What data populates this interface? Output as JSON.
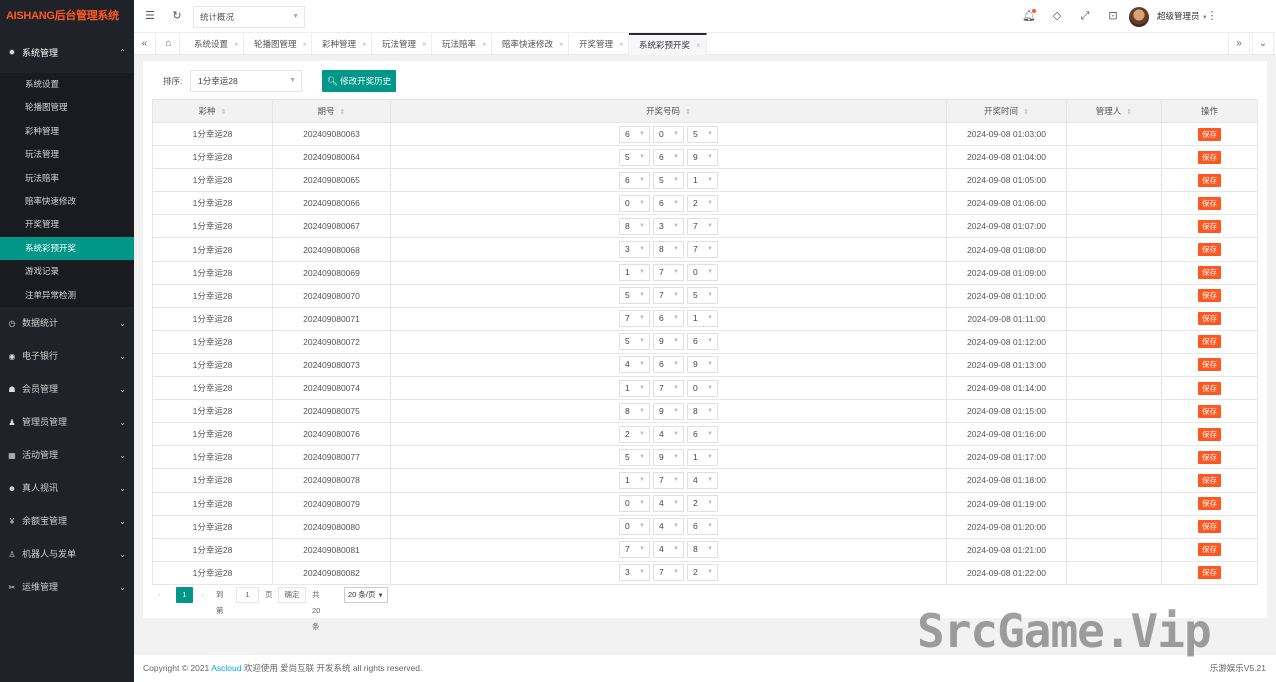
{
  "brand": {
    "logo_text": "AISHANG后台管理系统",
    "accent": "#009688",
    "danger": "#ff5722"
  },
  "sidebar": {
    "groups": [
      {
        "label": "系统管理",
        "icon": "gear-icon",
        "expanded": true,
        "items": [
          "系统设置",
          "轮播图管理",
          "彩种管理",
          "玩法管理",
          "玩法赔率",
          "赔率快速修改",
          "开奖管理",
          "系统彩预开奖",
          "游戏记录",
          "注单异常检测"
        ],
        "active_index": 7
      },
      {
        "label": "数据统计",
        "icon": "clock-icon"
      },
      {
        "label": "电子银行",
        "icon": "coin-icon"
      },
      {
        "label": "会员管理",
        "icon": "user-group-icon"
      },
      {
        "label": "管理员管理",
        "icon": "admin-icon"
      },
      {
        "label": "活动管理",
        "icon": "calendar-icon"
      },
      {
        "label": "真人视讯",
        "icon": "users-icon"
      },
      {
        "label": "余额宝管理",
        "icon": "yen-icon"
      },
      {
        "label": "机器人与发单",
        "icon": "robot-icon"
      },
      {
        "label": "运维管理",
        "icon": "tools-icon"
      }
    ]
  },
  "topbar": {
    "dropdown_value": "统计概况",
    "username": "超级管理员"
  },
  "tabs": {
    "items": [
      "系统设置",
      "轮播图管理",
      "彩种管理",
      "玩法管理",
      "玩法赔率",
      "赔率快速修改",
      "开奖管理",
      "系统彩预开奖"
    ],
    "active_index": 7
  },
  "toolbar": {
    "sort_label": "排序:",
    "sort_value": "1分幸运28",
    "history_button": "修改开奖历史"
  },
  "table": {
    "columns": [
      "彩种",
      "期号",
      "开奖号码",
      "开奖时间",
      "管理人",
      "操作"
    ],
    "action_label": "保存",
    "rows": [
      {
        "lottery": "1分幸运28",
        "issue": "202409080063",
        "digits": [
          "6",
          "0",
          "5"
        ],
        "time": "2024-09-08 01:03:00",
        "manager": ""
      },
      {
        "lottery": "1分幸运28",
        "issue": "202409080064",
        "digits": [
          "5",
          "6",
          "9"
        ],
        "time": "2024-09-08 01:04:00",
        "manager": ""
      },
      {
        "lottery": "1分幸运28",
        "issue": "202409080065",
        "digits": [
          "6",
          "5",
          "1"
        ],
        "time": "2024-09-08 01:05:00",
        "manager": ""
      },
      {
        "lottery": "1分幸运28",
        "issue": "202409080066",
        "digits": [
          "0",
          "6",
          "2"
        ],
        "time": "2024-09-08 01:06:00",
        "manager": ""
      },
      {
        "lottery": "1分幸运28",
        "issue": "202409080067",
        "digits": [
          "8",
          "3",
          "7"
        ],
        "time": "2024-09-08 01:07:00",
        "manager": ""
      },
      {
        "lottery": "1分幸运28",
        "issue": "202409080068",
        "digits": [
          "3",
          "8",
          "7"
        ],
        "time": "2024-09-08 01:08:00",
        "manager": ""
      },
      {
        "lottery": "1分幸运28",
        "issue": "202409080069",
        "digits": [
          "1",
          "7",
          "0"
        ],
        "time": "2024-09-08 01:09:00",
        "manager": ""
      },
      {
        "lottery": "1分幸运28",
        "issue": "202409080070",
        "digits": [
          "5",
          "7",
          "5"
        ],
        "time": "2024-09-08 01:10:00",
        "manager": ""
      },
      {
        "lottery": "1分幸运28",
        "issue": "202409080071",
        "digits": [
          "7",
          "6",
          "1"
        ],
        "time": "2024-09-08 01:11:00",
        "manager": ""
      },
      {
        "lottery": "1分幸运28",
        "issue": "202409080072",
        "digits": [
          "5",
          "9",
          "6"
        ],
        "time": "2024-09-08 01:12:00",
        "manager": ""
      },
      {
        "lottery": "1分幸运28",
        "issue": "202409080073",
        "digits": [
          "4",
          "6",
          "9"
        ],
        "time": "2024-09-08 01:13:00",
        "manager": ""
      },
      {
        "lottery": "1分幸运28",
        "issue": "202409080074",
        "digits": [
          "1",
          "7",
          "0"
        ],
        "time": "2024-09-08 01:14:00",
        "manager": ""
      },
      {
        "lottery": "1分幸运28",
        "issue": "202409080075",
        "digits": [
          "8",
          "9",
          "8"
        ],
        "time": "2024-09-08 01:15:00",
        "manager": ""
      },
      {
        "lottery": "1分幸运28",
        "issue": "202409080076",
        "digits": [
          "2",
          "4",
          "6"
        ],
        "time": "2024-09-08 01:16:00",
        "manager": ""
      },
      {
        "lottery": "1分幸运28",
        "issue": "202409080077",
        "digits": [
          "5",
          "9",
          "1"
        ],
        "time": "2024-09-08 01:17:00",
        "manager": ""
      },
      {
        "lottery": "1分幸运28",
        "issue": "202409080078",
        "digits": [
          "1",
          "7",
          "4"
        ],
        "time": "2024-09-08 01:18:00",
        "manager": ""
      },
      {
        "lottery": "1分幸运28",
        "issue": "202409080079",
        "digits": [
          "0",
          "4",
          "2"
        ],
        "time": "2024-09-08 01:19:00",
        "manager": ""
      },
      {
        "lottery": "1分幸运28",
        "issue": "202409080080",
        "digits": [
          "0",
          "4",
          "6"
        ],
        "time": "2024-09-08 01:20:00",
        "manager": ""
      },
      {
        "lottery": "1分幸运28",
        "issue": "202409080081",
        "digits": [
          "7",
          "4",
          "8"
        ],
        "time": "2024-09-08 01:21:00",
        "manager": ""
      },
      {
        "lottery": "1分幸运28",
        "issue": "202409080082",
        "digits": [
          "3",
          "7",
          "2"
        ],
        "time": "2024-09-08 01:22:00",
        "manager": ""
      }
    ]
  },
  "pager": {
    "current_page": "1",
    "goto_label": "到第",
    "goto_value": "1",
    "page_unit": "页",
    "confirm_label": "确定",
    "total_label": "共 20 条",
    "page_size": "20 条/页"
  },
  "footer": {
    "copyright_prefix": "Copyright © 2021",
    "company_link": "Ascloud",
    "copyright_suffix": "欢迎使用 爱尚互联 开发系统 all rights reserved.",
    "version": "乐游娱乐V5.21"
  },
  "watermark": "SrcGame.Vip"
}
